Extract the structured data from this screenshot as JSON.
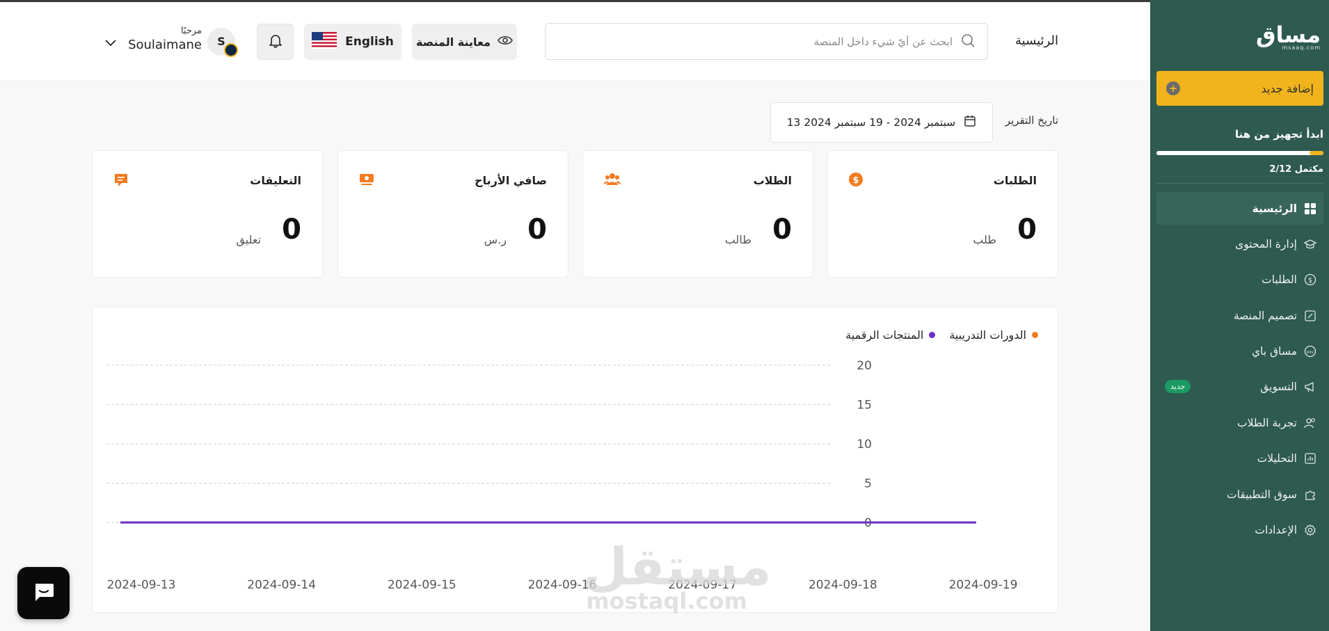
{
  "sidebar": {
    "logo_text": "مساق",
    "logo_sub": "msaaq.com",
    "add_new": "إضافة جديد",
    "setup_title": "ابدأ تجهيز من هنا",
    "progress_fraction": 0.0833,
    "progress_text": "2/12 مكتمل",
    "items": [
      {
        "label": "الرئيسية",
        "icon": "dashboard-grid-icon",
        "active": true
      },
      {
        "label": "إدارة المحتوى",
        "icon": "graduation-cap-icon"
      },
      {
        "label": "الطلبات",
        "icon": "dollar-circle-icon"
      },
      {
        "label": "تصميم المنصة",
        "icon": "design-edit-icon"
      },
      {
        "label": "مساق باي",
        "icon": "pay-icon"
      },
      {
        "label": "التسويق",
        "icon": "megaphone-icon",
        "badge": "جديد"
      },
      {
        "label": "تجربة الطلاب",
        "icon": "users-icon"
      },
      {
        "label": "التحليلات",
        "icon": "bar-chart-icon"
      },
      {
        "label": "سوق التطبيقات",
        "icon": "puzzle-icon"
      },
      {
        "label": "الإعدادات",
        "icon": "gear-icon"
      }
    ]
  },
  "header": {
    "page_title": "الرئيسية",
    "search_placeholder": "ابحث عن أيّ شيء داخل المنصة",
    "preview_label": "معاينة المنصة",
    "language_label": "English",
    "greeting": "مرحبًا",
    "user_name": "Soulaimane",
    "avatar_initial": "S"
  },
  "report": {
    "label": "تاريخ التقرير",
    "range": "13 سبتمبر 2024 - 19 سبتمبر 2024"
  },
  "stats": [
    {
      "title": "الطلبات",
      "value": "0",
      "unit": "طلب",
      "icon": "dollar-circle-icon",
      "color": "#f47b20"
    },
    {
      "title": "الطلاب",
      "value": "0",
      "unit": "طالب",
      "icon": "users-group-icon",
      "color": "#f47b20"
    },
    {
      "title": "صافي الأرباح",
      "value": "0",
      "unit": "ر.س",
      "icon": "money-icon",
      "color": "#f47b20"
    },
    {
      "title": "التعليقات",
      "value": "0",
      "unit": "تعليق",
      "icon": "comment-icon",
      "color": "#f47b20"
    }
  ],
  "chart_data": {
    "type": "line",
    "x": [
      "2024-09-13",
      "2024-09-14",
      "2024-09-15",
      "2024-09-16",
      "2024-09-17",
      "2024-09-18",
      "2024-09-19"
    ],
    "series": [
      {
        "name": "الدورات التدريبية",
        "color": "#f47b20",
        "values": [
          0,
          0,
          0,
          0,
          0,
          0,
          0
        ]
      },
      {
        "name": "المنتجات الرقمية",
        "color": "#6a2fc4",
        "values": [
          0,
          0,
          0,
          0,
          0,
          0,
          0
        ]
      }
    ],
    "yticks": [
      0,
      5,
      10,
      15,
      20
    ],
    "ylim": [
      0,
      20
    ],
    "grid": true,
    "legend_position": "top-right"
  },
  "watermark": {
    "ar": "مستقل",
    "en": "mostaql.com"
  },
  "colors": {
    "sidebar_bg": "#2e5a4f",
    "accent": "#f2b41c",
    "orange": "#f47b20",
    "purple": "#6a2fc4"
  }
}
